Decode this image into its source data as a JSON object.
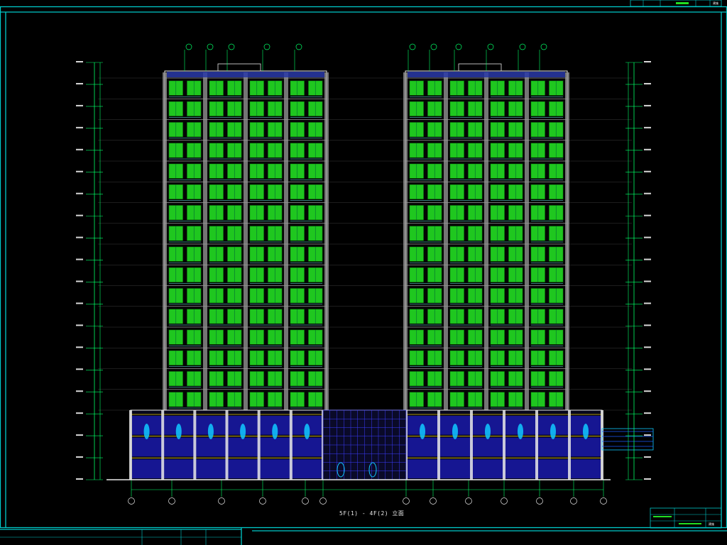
{
  "drawing": {
    "caption": "5F(1) - 4F(2) 立面",
    "floors_per_tower": 16,
    "bays_per_tower": 4,
    "towers": 2,
    "podium_floors": 3
  },
  "colors": {
    "background": "#000000",
    "frame": "#00c8c8",
    "window_green": "#22dd22",
    "structure_grey": "#9a9a9a",
    "podium_blue": "#1a1aa8",
    "dimension_line": "#00ff66",
    "pier_white": "#e8e8e8",
    "axis_label": "#ffffff"
  },
  "title_block": {
    "top_right": "建施",
    "bottom_right": "建施"
  }
}
